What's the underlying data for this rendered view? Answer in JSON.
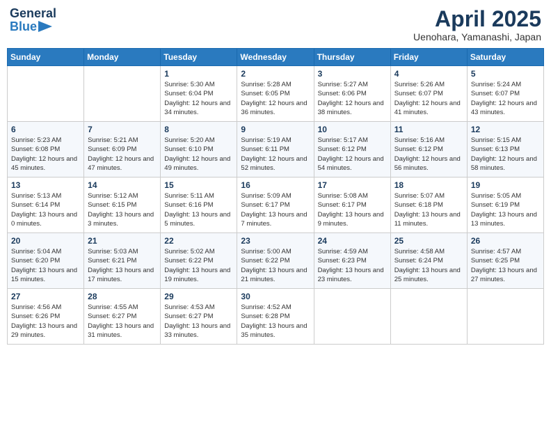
{
  "header": {
    "logo_general": "General",
    "logo_blue": "Blue",
    "month_title": "April 2025",
    "location": "Uenohara, Yamanashi, Japan"
  },
  "weekdays": [
    "Sunday",
    "Monday",
    "Tuesday",
    "Wednesday",
    "Thursday",
    "Friday",
    "Saturday"
  ],
  "weeks": [
    [
      {
        "day": "",
        "sunrise": "",
        "sunset": "",
        "daylight": ""
      },
      {
        "day": "",
        "sunrise": "",
        "sunset": "",
        "daylight": ""
      },
      {
        "day": "1",
        "sunrise": "Sunrise: 5:30 AM",
        "sunset": "Sunset: 6:04 PM",
        "daylight": "Daylight: 12 hours and 34 minutes."
      },
      {
        "day": "2",
        "sunrise": "Sunrise: 5:28 AM",
        "sunset": "Sunset: 6:05 PM",
        "daylight": "Daylight: 12 hours and 36 minutes."
      },
      {
        "day": "3",
        "sunrise": "Sunrise: 5:27 AM",
        "sunset": "Sunset: 6:06 PM",
        "daylight": "Daylight: 12 hours and 38 minutes."
      },
      {
        "day": "4",
        "sunrise": "Sunrise: 5:26 AM",
        "sunset": "Sunset: 6:07 PM",
        "daylight": "Daylight: 12 hours and 41 minutes."
      },
      {
        "day": "5",
        "sunrise": "Sunrise: 5:24 AM",
        "sunset": "Sunset: 6:07 PM",
        "daylight": "Daylight: 12 hours and 43 minutes."
      }
    ],
    [
      {
        "day": "6",
        "sunrise": "Sunrise: 5:23 AM",
        "sunset": "Sunset: 6:08 PM",
        "daylight": "Daylight: 12 hours and 45 minutes."
      },
      {
        "day": "7",
        "sunrise": "Sunrise: 5:21 AM",
        "sunset": "Sunset: 6:09 PM",
        "daylight": "Daylight: 12 hours and 47 minutes."
      },
      {
        "day": "8",
        "sunrise": "Sunrise: 5:20 AM",
        "sunset": "Sunset: 6:10 PM",
        "daylight": "Daylight: 12 hours and 49 minutes."
      },
      {
        "day": "9",
        "sunrise": "Sunrise: 5:19 AM",
        "sunset": "Sunset: 6:11 PM",
        "daylight": "Daylight: 12 hours and 52 minutes."
      },
      {
        "day": "10",
        "sunrise": "Sunrise: 5:17 AM",
        "sunset": "Sunset: 6:12 PM",
        "daylight": "Daylight: 12 hours and 54 minutes."
      },
      {
        "day": "11",
        "sunrise": "Sunrise: 5:16 AM",
        "sunset": "Sunset: 6:12 PM",
        "daylight": "Daylight: 12 hours and 56 minutes."
      },
      {
        "day": "12",
        "sunrise": "Sunrise: 5:15 AM",
        "sunset": "Sunset: 6:13 PM",
        "daylight": "Daylight: 12 hours and 58 minutes."
      }
    ],
    [
      {
        "day": "13",
        "sunrise": "Sunrise: 5:13 AM",
        "sunset": "Sunset: 6:14 PM",
        "daylight": "Daylight: 13 hours and 0 minutes."
      },
      {
        "day": "14",
        "sunrise": "Sunrise: 5:12 AM",
        "sunset": "Sunset: 6:15 PM",
        "daylight": "Daylight: 13 hours and 3 minutes."
      },
      {
        "day": "15",
        "sunrise": "Sunrise: 5:11 AM",
        "sunset": "Sunset: 6:16 PM",
        "daylight": "Daylight: 13 hours and 5 minutes."
      },
      {
        "day": "16",
        "sunrise": "Sunrise: 5:09 AM",
        "sunset": "Sunset: 6:17 PM",
        "daylight": "Daylight: 13 hours and 7 minutes."
      },
      {
        "day": "17",
        "sunrise": "Sunrise: 5:08 AM",
        "sunset": "Sunset: 6:17 PM",
        "daylight": "Daylight: 13 hours and 9 minutes."
      },
      {
        "day": "18",
        "sunrise": "Sunrise: 5:07 AM",
        "sunset": "Sunset: 6:18 PM",
        "daylight": "Daylight: 13 hours and 11 minutes."
      },
      {
        "day": "19",
        "sunrise": "Sunrise: 5:05 AM",
        "sunset": "Sunset: 6:19 PM",
        "daylight": "Daylight: 13 hours and 13 minutes."
      }
    ],
    [
      {
        "day": "20",
        "sunrise": "Sunrise: 5:04 AM",
        "sunset": "Sunset: 6:20 PM",
        "daylight": "Daylight: 13 hours and 15 minutes."
      },
      {
        "day": "21",
        "sunrise": "Sunrise: 5:03 AM",
        "sunset": "Sunset: 6:21 PM",
        "daylight": "Daylight: 13 hours and 17 minutes."
      },
      {
        "day": "22",
        "sunrise": "Sunrise: 5:02 AM",
        "sunset": "Sunset: 6:22 PM",
        "daylight": "Daylight: 13 hours and 19 minutes."
      },
      {
        "day": "23",
        "sunrise": "Sunrise: 5:00 AM",
        "sunset": "Sunset: 6:22 PM",
        "daylight": "Daylight: 13 hours and 21 minutes."
      },
      {
        "day": "24",
        "sunrise": "Sunrise: 4:59 AM",
        "sunset": "Sunset: 6:23 PM",
        "daylight": "Daylight: 13 hours and 23 minutes."
      },
      {
        "day": "25",
        "sunrise": "Sunrise: 4:58 AM",
        "sunset": "Sunset: 6:24 PM",
        "daylight": "Daylight: 13 hours and 25 minutes."
      },
      {
        "day": "26",
        "sunrise": "Sunrise: 4:57 AM",
        "sunset": "Sunset: 6:25 PM",
        "daylight": "Daylight: 13 hours and 27 minutes."
      }
    ],
    [
      {
        "day": "27",
        "sunrise": "Sunrise: 4:56 AM",
        "sunset": "Sunset: 6:26 PM",
        "daylight": "Daylight: 13 hours and 29 minutes."
      },
      {
        "day": "28",
        "sunrise": "Sunrise: 4:55 AM",
        "sunset": "Sunset: 6:27 PM",
        "daylight": "Daylight: 13 hours and 31 minutes."
      },
      {
        "day": "29",
        "sunrise": "Sunrise: 4:53 AM",
        "sunset": "Sunset: 6:27 PM",
        "daylight": "Daylight: 13 hours and 33 minutes."
      },
      {
        "day": "30",
        "sunrise": "Sunrise: 4:52 AM",
        "sunset": "Sunset: 6:28 PM",
        "daylight": "Daylight: 13 hours and 35 minutes."
      },
      {
        "day": "",
        "sunrise": "",
        "sunset": "",
        "daylight": ""
      },
      {
        "day": "",
        "sunrise": "",
        "sunset": "",
        "daylight": ""
      },
      {
        "day": "",
        "sunrise": "",
        "sunset": "",
        "daylight": ""
      }
    ]
  ]
}
